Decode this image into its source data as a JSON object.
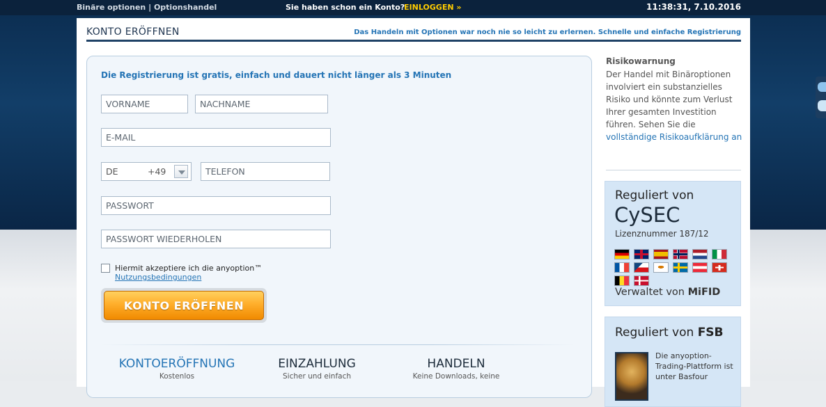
{
  "topbar": {
    "brand": "Binäre optionen | Optionshandel",
    "account_prompt": "Sie haben schon ein Konto?",
    "login_label": "EINLOGGEN »",
    "clock": "11:38:31, 7.10.2016"
  },
  "card": {
    "title": "KONTO ERÖFFNEN",
    "tagline": "Das Handeln mit Optionen war noch nie so leicht zu erlernen. Schnelle und einfache Registrierung"
  },
  "form": {
    "heading": "Die Registrierung ist gratis, einfach und dauert nicht länger als 3 Minuten",
    "first_name_placeholder": "VORNAME",
    "last_name_placeholder": "NACHNAME",
    "email_placeholder": "E-MAIL",
    "country_code": "DE",
    "dial_code": "+49",
    "phone_placeholder": "TELEFON",
    "password_placeholder": "PASSWORT",
    "password_repeat_placeholder": "PASSWORT WIEDERHOLEN",
    "terms_text": "Hiermit akzeptiere ich die anyoption™",
    "terms_link": "Nutzungsbedingungen",
    "submit_label": "KONTO ERÖFFNEN"
  },
  "steps": [
    {
      "title": "KONTOERÖFFNUNG",
      "subtitle": "Kostenlos",
      "color": "#2474b5"
    },
    {
      "title": "EINZAHLUNG",
      "subtitle": "Sicher und einfach",
      "color": "#1c2b3a"
    },
    {
      "title": "HANDELN",
      "subtitle": "Keine Downloads, keine",
      "color": "#1c2b3a"
    }
  ],
  "risk": {
    "title": "Risikowarnung",
    "body": "Der Handel mit Binäroptionen involviert ein substanzielles Risiko und könnte zum Verlust Ihrer gesamten Investition führen. Sehen Sie die",
    "link": "vollständige Risikoaufklärung an"
  },
  "regulation_cysec": {
    "label": "Reguliert von",
    "authority": "CySEC",
    "license": "Lizenznummer 187/12",
    "managed_prefix": "Verwaltet von",
    "managed_by": "MiFID",
    "flags": [
      "germany-flag",
      "uk-flag",
      "spain-flag",
      "norway-flag",
      "netherlands-flag",
      "italy-flag",
      "france-flag",
      "czech-flag",
      "cyprus-flag",
      "sweden-flag",
      "austria-flag",
      "switzerland-flag",
      "belgium-flag",
      "denmark-flag"
    ]
  },
  "regulation_fsb": {
    "label": "Reguliert von",
    "authority": "FSB",
    "text": "Die anyoption-Trading-Plattform ist unter Basfour"
  },
  "colors": {
    "accent_blue": "#2474b5",
    "cta_orange": "#f08a00",
    "login_yellow": "#ffcc00"
  }
}
